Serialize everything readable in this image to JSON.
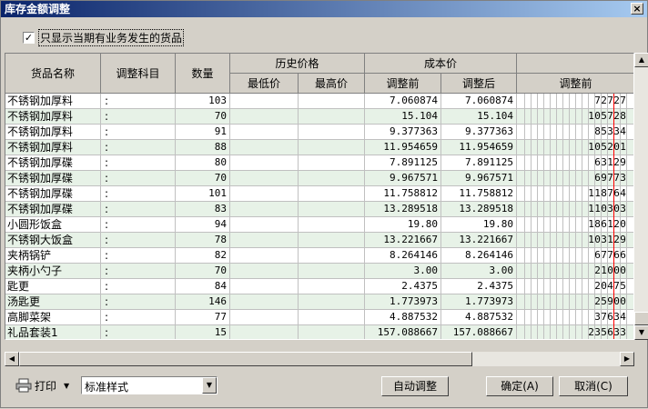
{
  "window": {
    "title": "库存金额调整",
    "close": "×"
  },
  "filter": {
    "checked": true,
    "check_mark": "✓",
    "label": "只显示当期有业务发生的货品"
  },
  "columns": {
    "name": "货品名称",
    "account": "调整科目",
    "qty": "数量",
    "hist_price": "历史价格",
    "min_price": "最低价",
    "max_price": "最高价",
    "cost_price": "成本价",
    "before": "调整前",
    "after": "调整后",
    "amount_before": "调整前"
  },
  "rows": [
    {
      "name": "不锈钢加厚料",
      "account": ":",
      "qty": "103",
      "before": "7.060874",
      "after": "7.060874",
      "amount": "727.27"
    },
    {
      "name": "不锈钢加厚料",
      "account": ":",
      "qty": "70",
      "before": "15.104",
      "after": "15.104",
      "amount": "1057.28"
    },
    {
      "name": "不锈钢加厚料",
      "account": ":",
      "qty": "91",
      "before": "9.377363",
      "after": "9.377363",
      "amount": "853.34"
    },
    {
      "name": "不锈钢加厚料",
      "account": ":",
      "qty": "88",
      "before": "11.954659",
      "after": "11.954659",
      "amount": "1052.01"
    },
    {
      "name": "不锈钢加厚碟",
      "account": ":",
      "qty": "80",
      "before": "7.891125",
      "after": "7.891125",
      "amount": "631.29"
    },
    {
      "name": "不锈钢加厚碟",
      "account": ":",
      "qty": "70",
      "before": "9.967571",
      "after": "9.967571",
      "amount": "697.73"
    },
    {
      "name": "不锈钢加厚碟",
      "account": ":",
      "qty": "101",
      "before": "11.758812",
      "after": "11.758812",
      "amount": "1187.64"
    },
    {
      "name": "不锈钢加厚碟",
      "account": ":",
      "qty": "83",
      "before": "13.289518",
      "after": "13.289518",
      "amount": "1103.03"
    },
    {
      "name": "小圆形饭盒",
      "account": ":",
      "qty": "94",
      "before": "19.80",
      "after": "19.80",
      "amount": "1861.20"
    },
    {
      "name": "不锈钢大饭盒",
      "account": ":",
      "qty": "78",
      "before": "13.221667",
      "after": "13.221667",
      "amount": "1031.29"
    },
    {
      "name": "夹柄锅铲",
      "account": ":",
      "qty": "82",
      "before": "8.264146",
      "after": "8.264146",
      "amount": "677.66"
    },
    {
      "name": "夹柄小勺子",
      "account": ":",
      "qty": "70",
      "before": "3.00",
      "after": "3.00",
      "amount": "210.00"
    },
    {
      "name": "匙更",
      "account": ":",
      "qty": "84",
      "before": "2.4375",
      "after": "2.4375",
      "amount": "204.75"
    },
    {
      "name": "汤匙更",
      "account": ":",
      "qty": "146",
      "before": "1.773973",
      "after": "1.773973",
      "amount": "259.00"
    },
    {
      "name": "高脚菜架",
      "account": ":",
      "qty": "77",
      "before": "4.887532",
      "after": "4.887532",
      "amount": "376.34"
    },
    {
      "name": "礼品套装1",
      "account": ":",
      "qty": "15",
      "before": "157.088667",
      "after": "157.088667",
      "amount": "2356.33"
    }
  ],
  "footer": {
    "print_label": "打印",
    "style_value": "标准样式",
    "auto_adjust": "自动调整",
    "ok": "确定(A)",
    "cancel": "取消(C)"
  }
}
